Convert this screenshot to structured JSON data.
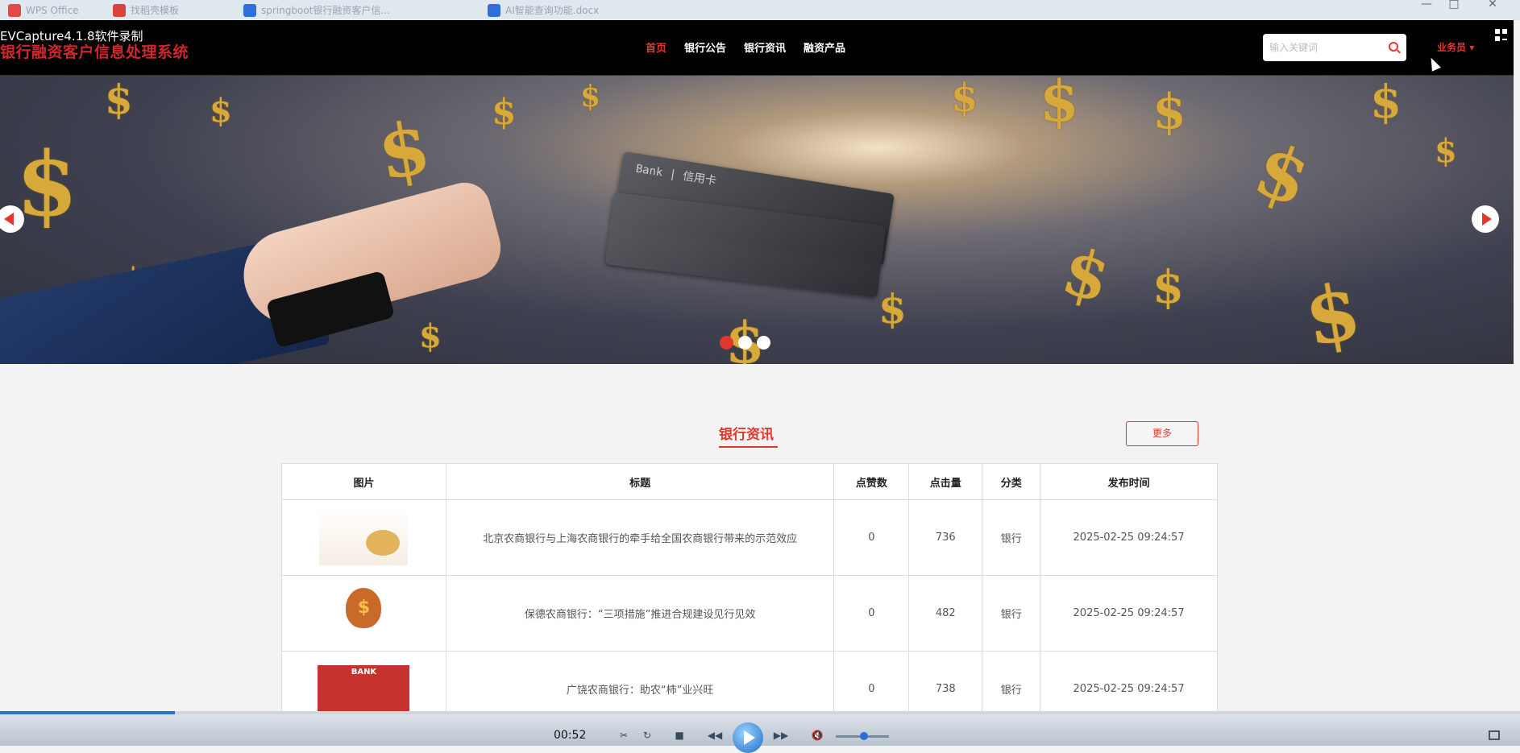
{
  "os": {
    "tabs": [
      {
        "label": "WPS Office",
        "color": "#e24a4a"
      },
      {
        "label": "找稻壳模板",
        "color": "#d9443f"
      },
      {
        "label": "springboot银行融资客户信...",
        "color": "#2f6fdc"
      },
      {
        "label": "AI智能查询功能.docx",
        "color": "#2f6fdc"
      }
    ]
  },
  "recorder": {
    "watermark": "EVCapture4.1.8软件录制"
  },
  "header": {
    "brand": "银行融资客户信息处理系统",
    "nav": [
      "首页",
      "银行公告",
      "银行资讯",
      "融资产品"
    ],
    "active_nav": "首页",
    "search_placeholder": "输入关键词",
    "user_label": "业务员"
  },
  "banner": {
    "active_slide": 1,
    "slide_count": 3,
    "card_text": "Bank | 信用卡"
  },
  "news": {
    "title": "银行资讯",
    "more_label": "更多",
    "columns": [
      "图片",
      "标题",
      "点赞数",
      "点击量",
      "分类",
      "发布时间"
    ],
    "rows": [
      {
        "title": "北京农商银行与上海农商银行的牵手给全国农商银行带来的示范效应",
        "likes": "0",
        "clicks": "736",
        "category": "银行",
        "time": "2025-02-25 09:24:57",
        "thumb": "piggy-bank"
      },
      {
        "title": "保德农商银行：“三项措施”推进合规建设见行见效",
        "likes": "0",
        "clicks": "482",
        "category": "银行",
        "time": "2025-02-25 09:24:57",
        "thumb": "money-bag"
      },
      {
        "title": "广饶农商银行：助农“柿”业兴旺",
        "likes": "0",
        "clicks": "738",
        "category": "银行",
        "time": "2025-02-25 09:24:57",
        "thumb": "bank-building"
      }
    ]
  },
  "player": {
    "time": "00:52",
    "progress": 0.115,
    "volume": 0.45
  }
}
